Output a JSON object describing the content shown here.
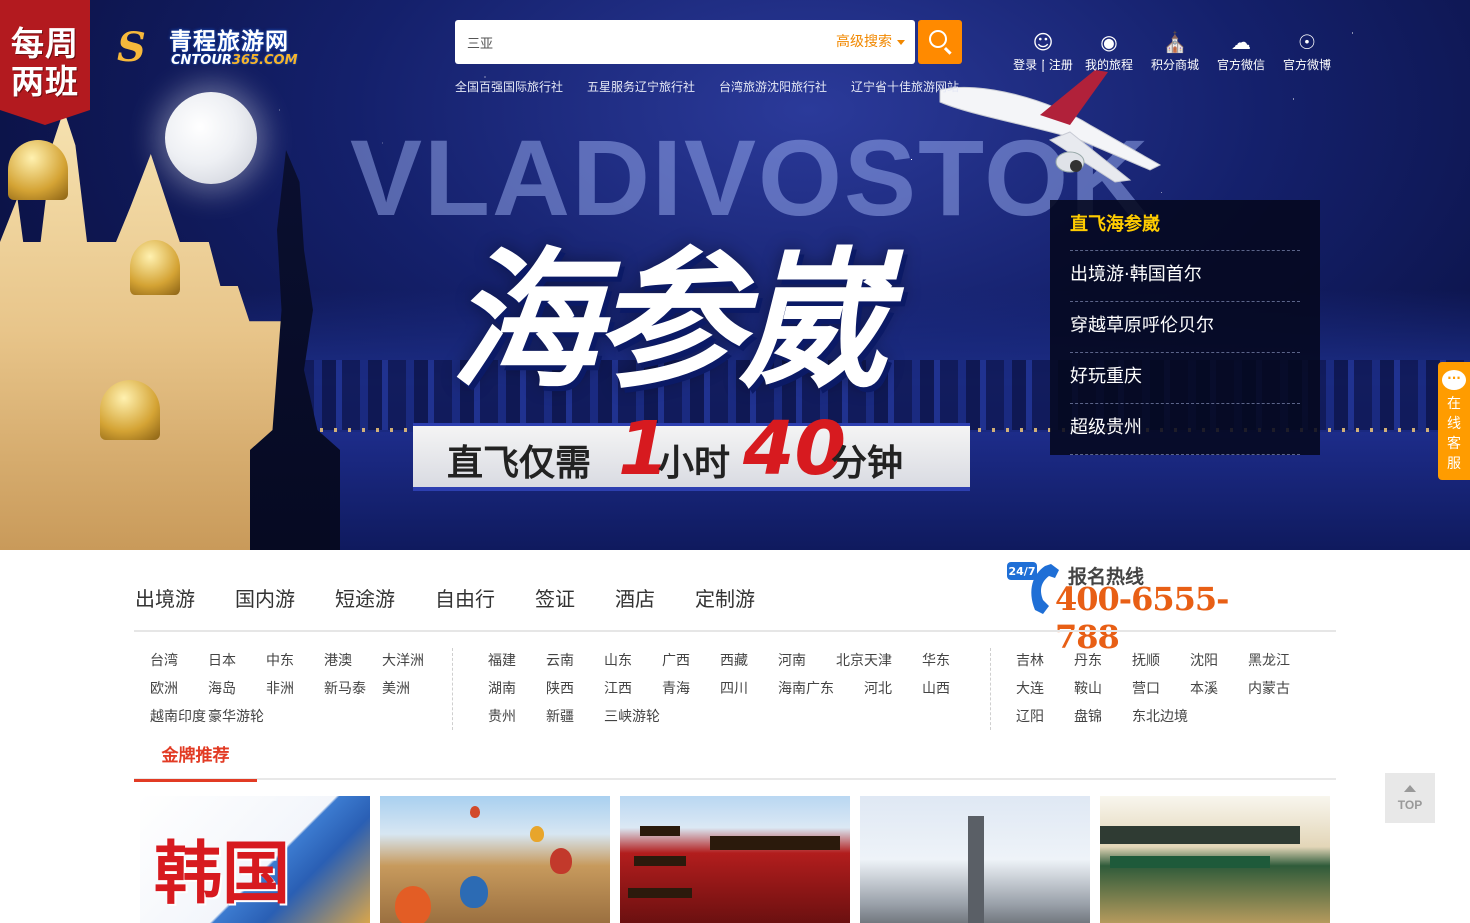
{
  "badge": {
    "text": "每周两班"
  },
  "logo": {
    "cn": "青程旅游网",
    "en_prefix": "CNTOUR",
    "en_suffix": "365.COM"
  },
  "search": {
    "value": "三亚",
    "advanced_label": "高级搜索"
  },
  "hot_links": [
    "全国百强国际旅行社",
    "五星服务辽宁旅行社",
    "台湾旅游沈阳旅行社",
    "辽宁省十佳旅游网站"
  ],
  "top_nav": [
    {
      "label": "登录 | 注册",
      "icon": "user-icon"
    },
    {
      "label": "我的旅程",
      "icon": "location-pin-icon"
    },
    {
      "label": "积分商城",
      "icon": "store-icon"
    },
    {
      "label": "官方微信",
      "icon": "wechat-icon"
    },
    {
      "label": "官方微博",
      "icon": "weibo-icon"
    }
  ],
  "banner": {
    "sky_title": "VLADIVOSTOK",
    "title": "海参崴",
    "ribbon_a": "直飞仅需",
    "ribbon_n1": "1",
    "ribbon_b": "小时",
    "ribbon_n2": "40",
    "ribbon_c": "分钟"
  },
  "side_menu": [
    "直飞海参崴",
    "出境游·韩国首尔",
    "穿越草原呼伦贝尔",
    "好玩重庆",
    "超级贵州"
  ],
  "online_service": "在线客服",
  "main_nav": [
    "出境游",
    "国内游",
    "短途游",
    "自由行",
    "签证",
    "酒店",
    "定制游"
  ],
  "hotline": {
    "label": "报名热线",
    "number": "400-6555-788",
    "badge": "24/7"
  },
  "cities_outbound": [
    "台湾",
    "日本",
    "中东",
    "港澳",
    "大洋洲",
    "欧洲",
    "海岛",
    "非洲",
    "新马泰",
    "美洲",
    "越南印度",
    "豪华游轮"
  ],
  "cities_domestic": [
    "福建",
    "云南",
    "山东",
    "广西",
    "西藏",
    "河南",
    "北京天津",
    "华东",
    "湖南",
    "陕西",
    "江西",
    "青海",
    "四川",
    "海南广东",
    "河北",
    "山西",
    "贵州",
    "新疆",
    "三峡游轮"
  ],
  "cities_short": [
    "吉林",
    "丹东",
    "抚顺",
    "沈阳",
    "黑龙江",
    "大连",
    "鞍山",
    "营口",
    "本溪",
    "内蒙古",
    "辽阳",
    "盘锦",
    "东北边境"
  ],
  "section_tab": "金牌推荐",
  "cards": [
    {
      "title": "韩国"
    }
  ],
  "totop": "TOP",
  "colors": {
    "accent": "#ff8a00",
    "brand_red": "#e23b24",
    "hero_navy": "#14206b",
    "highlight": "#ffcc00"
  }
}
